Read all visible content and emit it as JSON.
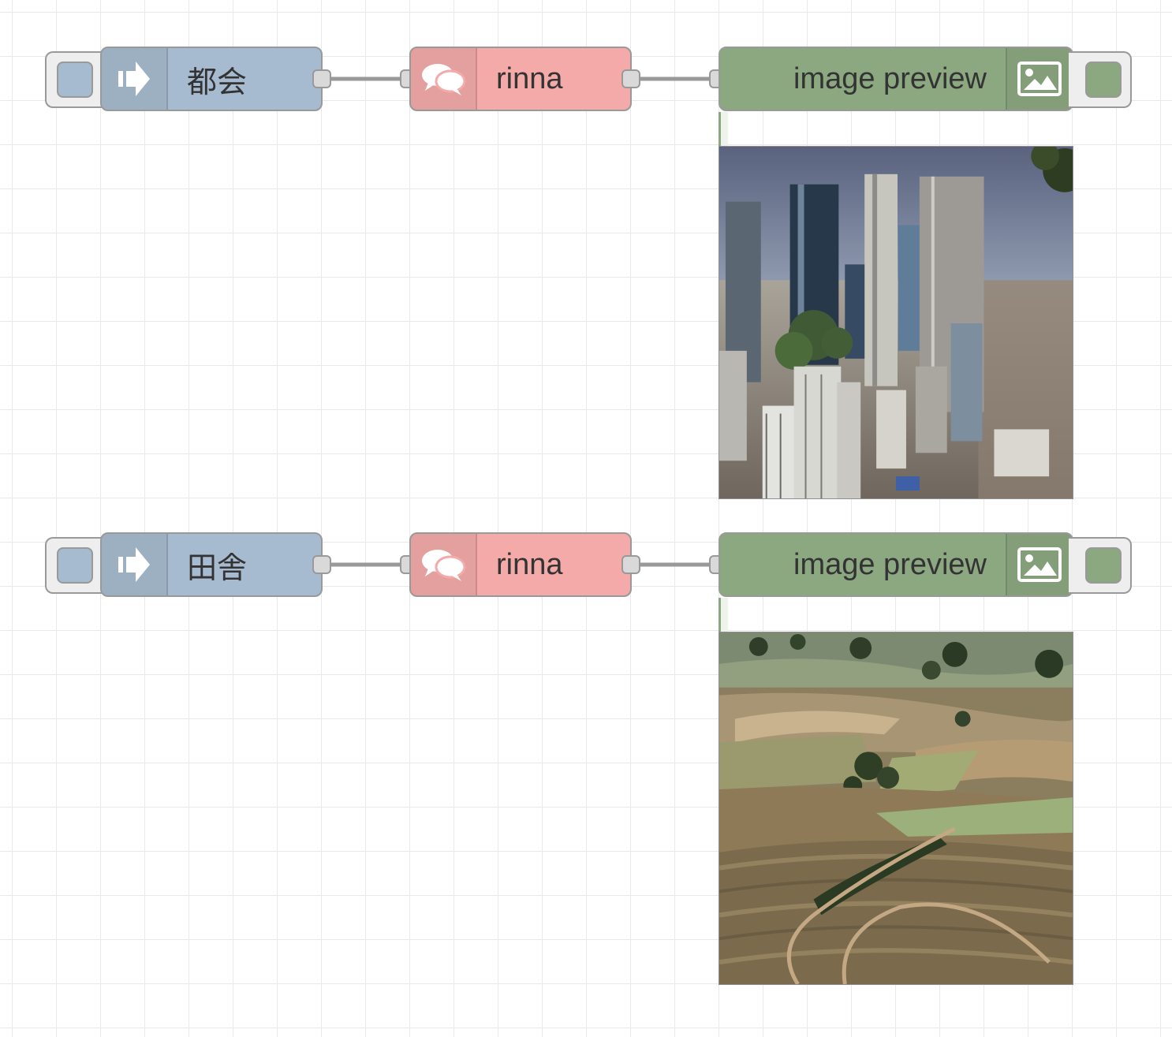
{
  "flows": [
    {
      "inject": {
        "label": "都会",
        "icon": "arrow-in-icon"
      },
      "model": {
        "label": "rinna",
        "icon": "chat-bubbles-icon"
      },
      "preview": {
        "label": "image preview",
        "icon": "image-icon"
      },
      "image": "city-skyline-image"
    },
    {
      "inject": {
        "label": "田舎",
        "icon": "arrow-in-icon"
      },
      "model": {
        "label": "rinna",
        "icon": "chat-bubbles-icon"
      },
      "preview": {
        "label": "image preview",
        "icon": "image-icon"
      },
      "image": "countryside-fields-image"
    }
  ],
  "colors": {
    "inject": "#a6bbcf",
    "model": "#f3aaa8",
    "preview": "#8ca881",
    "wire": "#999999"
  }
}
